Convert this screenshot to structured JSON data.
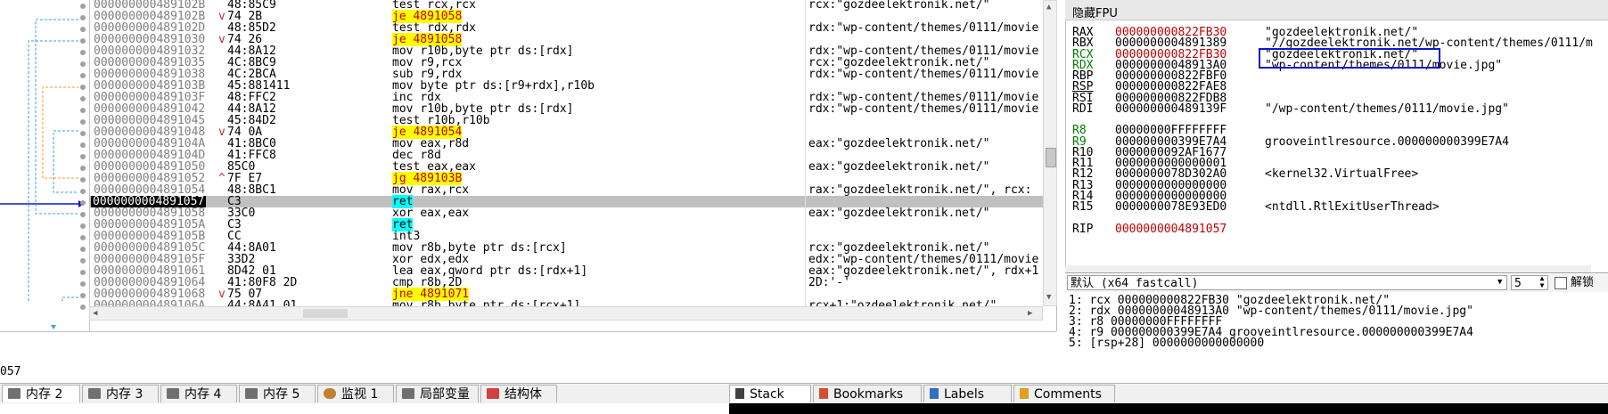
{
  "disasm": {
    "rows": [
      {
        "addr": "000000000489102B",
        "arr": "",
        "bytes": "48:85C9",
        "ins": [
          [
            "mn",
            "test "
          ],
          [
            "reg",
            "rcx,rcx"
          ]
        ],
        "cmt": "rcx:\"gozdeelektronik.net/\""
      },
      {
        "addr": "000000000489102B",
        "arr": "v",
        "bytes": "74 2B",
        "ins": [
          [
            "jmp",
            "je 4891058"
          ]
        ],
        "cmt": ""
      },
      {
        "addr": "000000000489102D",
        "arr": "",
        "bytes": "48:85D2",
        "ins": [
          [
            "mn",
            "test "
          ],
          [
            "reg",
            "rdx,rdx"
          ]
        ],
        "cmt": "rdx:\"wp-content/themes/0111/movie"
      },
      {
        "addr": "0000000004891030",
        "arr": "v",
        "bytes": "74 26",
        "ins": [
          [
            "jmp",
            "je 4891058"
          ]
        ],
        "cmt": ""
      },
      {
        "addr": "0000000004891032",
        "arr": "",
        "bytes": "44:8A12",
        "ins": [
          [
            "mn",
            "mov "
          ],
          [
            "reg",
            "r10b,byte ptr ds:[rdx]"
          ]
        ],
        "cmt": "rdx:\"wp-content/themes/0111/movie"
      },
      {
        "addr": "0000000004891035",
        "arr": "",
        "bytes": "4C:8BC9",
        "ins": [
          [
            "mn",
            "mov "
          ],
          [
            "reg",
            "r9,rcx"
          ]
        ],
        "cmt": "rcx:\"gozdeelektronik.net/\""
      },
      {
        "addr": "0000000004891038",
        "arr": "",
        "bytes": "4C:2BCA",
        "ins": [
          [
            "mn",
            "sub "
          ],
          [
            "reg",
            "r9,rdx"
          ]
        ],
        "cmt": "rdx:\"wp-content/themes/0111/movie"
      },
      {
        "addr": "000000000489103B",
        "arr": "",
        "bytes": "45:881411",
        "ins": [
          [
            "mn",
            "mov "
          ],
          [
            "reg",
            "byte ptr ds:[r9+rdx],r10b"
          ]
        ],
        "cmt": ""
      },
      {
        "addr": "000000000489103F",
        "arr": "",
        "bytes": "48:FFC2",
        "ins": [
          [
            "mn",
            "inc "
          ],
          [
            "reg",
            "rdx"
          ]
        ],
        "cmt": "rdx:\"wp-content/themes/0111/movie"
      },
      {
        "addr": "0000000004891042",
        "arr": "",
        "bytes": "44:8A12",
        "ins": [
          [
            "mn",
            "mov "
          ],
          [
            "reg",
            "r10b,byte ptr ds:[rdx]"
          ]
        ],
        "cmt": "rdx:\"wp-content/themes/0111/movie"
      },
      {
        "addr": "0000000004891045",
        "arr": "",
        "bytes": "45:84D2",
        "ins": [
          [
            "mn",
            "test "
          ],
          [
            "reg",
            "r10b,r10b"
          ]
        ],
        "cmt": ""
      },
      {
        "addr": "0000000004891048",
        "arr": "v",
        "bytes": "74 0A",
        "ins": [
          [
            "jmp",
            "je 4891054"
          ]
        ],
        "cmt": ""
      },
      {
        "addr": "000000000489104A",
        "arr": "",
        "bytes": "41:8BC0",
        "ins": [
          [
            "mn",
            "mov "
          ],
          [
            "reg",
            "eax,r8d"
          ]
        ],
        "cmt": "eax:\"gozdeelektronik.net/\""
      },
      {
        "addr": "000000000489104D",
        "arr": "",
        "bytes": "41:FFC8",
        "ins": [
          [
            "mn",
            "dec "
          ],
          [
            "reg",
            "r8d"
          ]
        ],
        "cmt": ""
      },
      {
        "addr": "0000000004891050",
        "arr": "",
        "bytes": "85C0",
        "ins": [
          [
            "mn",
            "test "
          ],
          [
            "reg",
            "eax,eax"
          ]
        ],
        "cmt": "eax:\"gozdeelektronik.net/\""
      },
      {
        "addr": "0000000004891052",
        "arr": "^",
        "bytes": "7F E7",
        "ins": [
          [
            "jmp",
            "jg 489103B"
          ]
        ],
        "cmt": ""
      },
      {
        "addr": "0000000004891054",
        "arr": "",
        "bytes": "48:8BC1",
        "ins": [
          [
            "mn",
            "mov "
          ],
          [
            "reg",
            "rax,rcx"
          ]
        ],
        "cmt": "rax:\"gozdeelektronik.net/\", rcx:"
      },
      {
        "addr": "0000000004891057",
        "arr": "",
        "bytes": "C3",
        "ins": [
          [
            "retk",
            "ret"
          ]
        ],
        "cmt": "",
        "sel": true
      },
      {
        "addr": "0000000004891058",
        "arr": "",
        "bytes": "33C0",
        "ins": [
          [
            "mn",
            "xor "
          ],
          [
            "reg",
            "eax,eax"
          ]
        ],
        "cmt": "eax:\"gozdeelektronik.net/\""
      },
      {
        "addr": "000000000489105A",
        "arr": "",
        "bytes": "C3",
        "ins": [
          [
            "retk",
            "ret"
          ]
        ],
        "cmt": ""
      },
      {
        "addr": "000000000489105B",
        "arr": "",
        "bytes": "CC",
        "ins": [
          [
            "mn",
            "int3"
          ]
        ],
        "cmt": ""
      },
      {
        "addr": "000000000489105C",
        "arr": "",
        "bytes": "44:8A01",
        "ins": [
          [
            "mn",
            "mov "
          ],
          [
            "reg",
            "r8b,byte ptr ds:[rcx]"
          ]
        ],
        "cmt": "rcx:\"gozdeelektronik.net/\""
      },
      {
        "addr": "000000000489105F",
        "arr": "",
        "bytes": "33D2",
        "ins": [
          [
            "mn",
            "xor "
          ],
          [
            "reg",
            "edx,edx"
          ]
        ],
        "cmt": "edx:\"wp-content/themes/0111/movie"
      },
      {
        "addr": "0000000004891061",
        "arr": "",
        "bytes": "8D42 01",
        "ins": [
          [
            "mn",
            "lea "
          ],
          [
            "reg",
            "eax,qword ptr ds:[rdx+1]"
          ]
        ],
        "cmt": "eax:\"gozdeelektronik.net/\", rdx+1"
      },
      {
        "addr": "0000000004891064",
        "arr": "",
        "bytes": "41:80F8 2D",
        "ins": [
          [
            "mn",
            "cmp "
          ],
          [
            "reg",
            "r8b,2D"
          ]
        ],
        "cmt": "2D:'-'"
      },
      {
        "addr": "0000000004891068",
        "arr": "v",
        "bytes": "75 07",
        "ins": [
          [
            "jmp",
            "jne 4891071"
          ]
        ],
        "cmt": ""
      },
      {
        "addr": "000000000489106A",
        "arr": "",
        "bytes": "44:8A41 01",
        "ins": [
          [
            "mn",
            "mov "
          ],
          [
            "reg",
            "r8b,byte ptr ds:[rcx+1]"
          ]
        ],
        "cmt": "rcx+1:\"ozdeelektronik.net/\""
      }
    ],
    "info_text": "057"
  },
  "registers": {
    "title": "隐藏FPU",
    "lines": [
      {
        "name": "RAX",
        "value": "000000000822FB30",
        "comment": "\"gozdeelektronik.net/\"",
        "red": true
      },
      {
        "name": "RBX",
        "value": "0000000004891389",
        "comment": "\"//gozdeelektronik.net/wp-content/themes/0111/m"
      },
      {
        "name": "RCX",
        "value": "000000000822FB30",
        "comment": "\"gozdeelektronik.net/\"",
        "red": true,
        "green": true
      },
      {
        "name": "RDX",
        "value": "00000000048913A0",
        "comment": "\"wp-content/themes/0111/movie.jpg\"",
        "green": true
      },
      {
        "name": "RBP",
        "value": "000000000822FBF0",
        "comment": ""
      },
      {
        "name": "RSP",
        "value": "000000000822FAE8",
        "comment": "",
        "underline": true
      },
      {
        "name": "RSI",
        "value": "000000000822FDB8",
        "comment": ""
      },
      {
        "name": "RDI",
        "value": "000000000489139F",
        "comment": "\"/wp-content/themes/0111/movie.jpg\""
      },
      {
        "name": "",
        "value": "",
        "comment": ""
      },
      {
        "name": "R8",
        "value": "00000000FFFFFFFF",
        "comment": "",
        "green": true
      },
      {
        "name": "R9",
        "value": "000000000399E7A4",
        "comment": "grooveintlresource.000000000399E7A4",
        "green": true
      },
      {
        "name": "R10",
        "value": "0000000092AF1677",
        "comment": ""
      },
      {
        "name": "R11",
        "value": "0000000000000001",
        "comment": ""
      },
      {
        "name": "R12",
        "value": "0000000078D302A0",
        "comment": "<kernel32.VirtualFree>"
      },
      {
        "name": "R13",
        "value": "0000000000000000",
        "comment": ""
      },
      {
        "name": "R14",
        "value": "0000000000000000",
        "comment": ""
      },
      {
        "name": "R15",
        "value": "0000000078E93ED0",
        "comment": "<ntdll.RtlExitUserThread>"
      },
      {
        "name": "",
        "value": "",
        "comment": ""
      },
      {
        "name": "RIP",
        "value": "0000000004891057",
        "comment": "",
        "red": true
      }
    ]
  },
  "callconv": {
    "selected": "默认 (x64 fastcall)",
    "count": "5",
    "unlock_label": "解锁",
    "args": [
      "1: rcx 000000000822FB30 \"gozdeelektronik.net/\"",
      "2: rdx 00000000048913A0 \"wp-content/themes/0111/movie.jpg\"",
      "3: r8 00000000FFFFFFFF",
      "4: r9 000000000399E7A4 grooveintlresource.000000000399E7A4",
      "5: [rsp+28] 0000000000000000"
    ]
  },
  "tabs_left": [
    {
      "label": "内存 2",
      "icon": "memory-icon",
      "active": true
    },
    {
      "label": "内存 3",
      "icon": "memory-icon"
    },
    {
      "label": "内存 4",
      "icon": "memory-icon"
    },
    {
      "label": "内存 5",
      "icon": "memory-icon"
    },
    {
      "label": "监视 1",
      "icon": "watch-icon"
    },
    {
      "label": "局部变量",
      "icon": "locals-icon"
    },
    {
      "label": "结构体",
      "icon": "struct-icon"
    }
  ],
  "tabs_right": [
    {
      "label": "Stack",
      "icon": "stack-icon",
      "active": true
    },
    {
      "label": "Bookmarks",
      "icon": "bookmark-icon"
    },
    {
      "label": "Labels",
      "icon": "label-icon"
    },
    {
      "label": "Comments",
      "icon": "comment-icon"
    }
  ],
  "colors": {
    "accent": "#1018c8",
    "address_red": "#c00000",
    "jump_bg": "#ffff00",
    "ret_bg": "#00ffff",
    "register_green": "#008000"
  }
}
